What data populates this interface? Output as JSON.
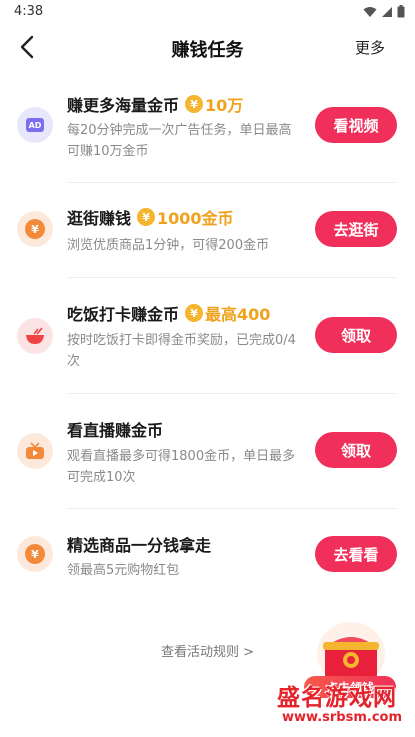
{
  "status_bar": {
    "time": "4:38",
    "icons": [
      "wifi-icon",
      "signal-icon",
      "battery-icon"
    ]
  },
  "nav": {
    "title": "赚钱任务",
    "more": "更多",
    "back_icon": "chevron-left-icon"
  },
  "coin_symbol": "¥",
  "tasks": [
    {
      "icon": "ad-icon",
      "icon_text": "AD",
      "title": "赚更多海量金币",
      "reward": "10万",
      "desc": "每20分钟完成一次广告任务，单日最高可赚10万金币",
      "button": "看视频"
    },
    {
      "icon": "yuan-coin-icon",
      "title": "逛街赚钱",
      "reward": "1000金币",
      "desc": "浏览优质商品1分钟，可得200金币",
      "button": "去逛街"
    },
    {
      "icon": "rice-bowl-icon",
      "title": "吃饭打卡赚金币",
      "reward": "最高400",
      "desc": "按时吃饭打卡即得金币奖励，已完成0/4次",
      "button": "领取"
    },
    {
      "icon": "live-tv-icon",
      "title": "看直播赚金币",
      "reward": "",
      "desc": "观看直播最多可得1800金币，单日最多可完成10次",
      "button": "领取"
    },
    {
      "icon": "yuan-coin-icon",
      "title": "精选商品一分钱拿走",
      "reward": "",
      "desc": "领最高5元购物红包",
      "button": "去看看"
    }
  ],
  "rules_link": "查看活动规则 >",
  "floating_widget": {
    "icon": "treasure-chest-icon",
    "label": "点击领钱"
  },
  "watermark": {
    "line1": "盛名游戏网",
    "line2": "www.srbsm.com"
  },
  "colors": {
    "accent": "#f0305a",
    "coin": "#f5b52e",
    "reward_text": "#f0a21c"
  }
}
